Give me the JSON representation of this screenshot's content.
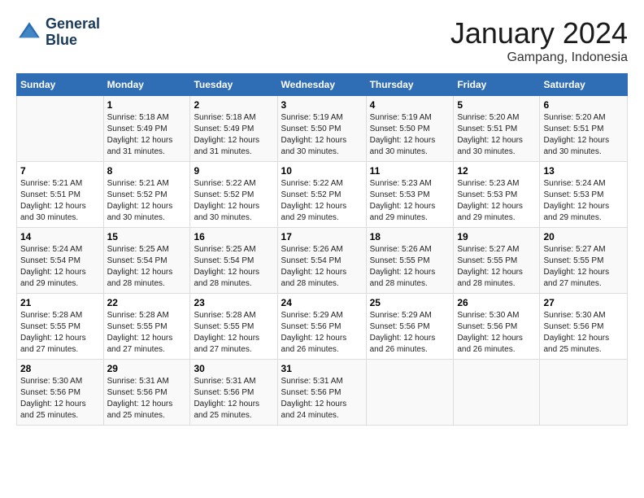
{
  "header": {
    "logo_line1": "General",
    "logo_line2": "Blue",
    "month": "January 2024",
    "location": "Gampang, Indonesia"
  },
  "days_of_week": [
    "Sunday",
    "Monday",
    "Tuesday",
    "Wednesday",
    "Thursday",
    "Friday",
    "Saturday"
  ],
  "weeks": [
    [
      {
        "day": "",
        "info": ""
      },
      {
        "day": "1",
        "info": "Sunrise: 5:18 AM\nSunset: 5:49 PM\nDaylight: 12 hours\nand 31 minutes."
      },
      {
        "day": "2",
        "info": "Sunrise: 5:18 AM\nSunset: 5:49 PM\nDaylight: 12 hours\nand 31 minutes."
      },
      {
        "day": "3",
        "info": "Sunrise: 5:19 AM\nSunset: 5:50 PM\nDaylight: 12 hours\nand 30 minutes."
      },
      {
        "day": "4",
        "info": "Sunrise: 5:19 AM\nSunset: 5:50 PM\nDaylight: 12 hours\nand 30 minutes."
      },
      {
        "day": "5",
        "info": "Sunrise: 5:20 AM\nSunset: 5:51 PM\nDaylight: 12 hours\nand 30 minutes."
      },
      {
        "day": "6",
        "info": "Sunrise: 5:20 AM\nSunset: 5:51 PM\nDaylight: 12 hours\nand 30 minutes."
      }
    ],
    [
      {
        "day": "7",
        "info": "Sunrise: 5:21 AM\nSunset: 5:51 PM\nDaylight: 12 hours\nand 30 minutes."
      },
      {
        "day": "8",
        "info": "Sunrise: 5:21 AM\nSunset: 5:52 PM\nDaylight: 12 hours\nand 30 minutes."
      },
      {
        "day": "9",
        "info": "Sunrise: 5:22 AM\nSunset: 5:52 PM\nDaylight: 12 hours\nand 30 minutes."
      },
      {
        "day": "10",
        "info": "Sunrise: 5:22 AM\nSunset: 5:52 PM\nDaylight: 12 hours\nand 29 minutes."
      },
      {
        "day": "11",
        "info": "Sunrise: 5:23 AM\nSunset: 5:53 PM\nDaylight: 12 hours\nand 29 minutes."
      },
      {
        "day": "12",
        "info": "Sunrise: 5:23 AM\nSunset: 5:53 PM\nDaylight: 12 hours\nand 29 minutes."
      },
      {
        "day": "13",
        "info": "Sunrise: 5:24 AM\nSunset: 5:53 PM\nDaylight: 12 hours\nand 29 minutes."
      }
    ],
    [
      {
        "day": "14",
        "info": "Sunrise: 5:24 AM\nSunset: 5:54 PM\nDaylight: 12 hours\nand 29 minutes."
      },
      {
        "day": "15",
        "info": "Sunrise: 5:25 AM\nSunset: 5:54 PM\nDaylight: 12 hours\nand 28 minutes."
      },
      {
        "day": "16",
        "info": "Sunrise: 5:25 AM\nSunset: 5:54 PM\nDaylight: 12 hours\nand 28 minutes."
      },
      {
        "day": "17",
        "info": "Sunrise: 5:26 AM\nSunset: 5:54 PM\nDaylight: 12 hours\nand 28 minutes."
      },
      {
        "day": "18",
        "info": "Sunrise: 5:26 AM\nSunset: 5:55 PM\nDaylight: 12 hours\nand 28 minutes."
      },
      {
        "day": "19",
        "info": "Sunrise: 5:27 AM\nSunset: 5:55 PM\nDaylight: 12 hours\nand 28 minutes."
      },
      {
        "day": "20",
        "info": "Sunrise: 5:27 AM\nSunset: 5:55 PM\nDaylight: 12 hours\nand 27 minutes."
      }
    ],
    [
      {
        "day": "21",
        "info": "Sunrise: 5:28 AM\nSunset: 5:55 PM\nDaylight: 12 hours\nand 27 minutes."
      },
      {
        "day": "22",
        "info": "Sunrise: 5:28 AM\nSunset: 5:55 PM\nDaylight: 12 hours\nand 27 minutes."
      },
      {
        "day": "23",
        "info": "Sunrise: 5:28 AM\nSunset: 5:55 PM\nDaylight: 12 hours\nand 27 minutes."
      },
      {
        "day": "24",
        "info": "Sunrise: 5:29 AM\nSunset: 5:56 PM\nDaylight: 12 hours\nand 26 minutes."
      },
      {
        "day": "25",
        "info": "Sunrise: 5:29 AM\nSunset: 5:56 PM\nDaylight: 12 hours\nand 26 minutes."
      },
      {
        "day": "26",
        "info": "Sunrise: 5:30 AM\nSunset: 5:56 PM\nDaylight: 12 hours\nand 26 minutes."
      },
      {
        "day": "27",
        "info": "Sunrise: 5:30 AM\nSunset: 5:56 PM\nDaylight: 12 hours\nand 25 minutes."
      }
    ],
    [
      {
        "day": "28",
        "info": "Sunrise: 5:30 AM\nSunset: 5:56 PM\nDaylight: 12 hours\nand 25 minutes."
      },
      {
        "day": "29",
        "info": "Sunrise: 5:31 AM\nSunset: 5:56 PM\nDaylight: 12 hours\nand 25 minutes."
      },
      {
        "day": "30",
        "info": "Sunrise: 5:31 AM\nSunset: 5:56 PM\nDaylight: 12 hours\nand 25 minutes."
      },
      {
        "day": "31",
        "info": "Sunrise: 5:31 AM\nSunset: 5:56 PM\nDaylight: 12 hours\nand 24 minutes."
      },
      {
        "day": "",
        "info": ""
      },
      {
        "day": "",
        "info": ""
      },
      {
        "day": "",
        "info": ""
      }
    ]
  ]
}
